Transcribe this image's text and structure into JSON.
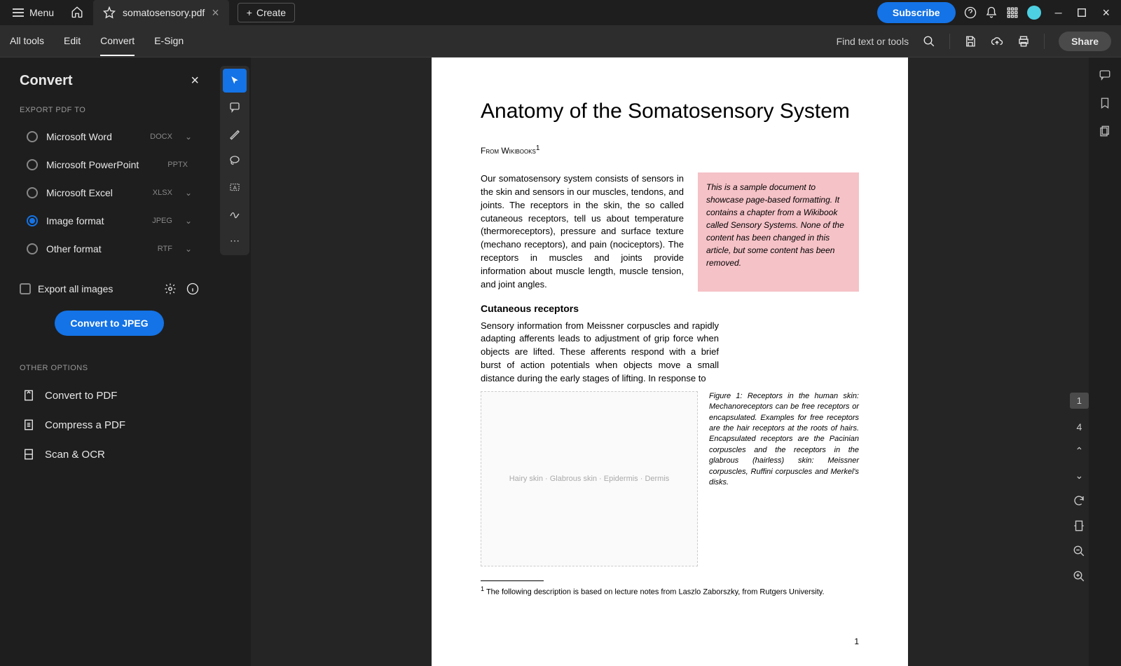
{
  "titlebar": {
    "menu": "Menu",
    "tab_title": "somatosensory.pdf",
    "create": "Create",
    "subscribe": "Subscribe"
  },
  "toolbar": {
    "all_tools": "All tools",
    "edit": "Edit",
    "convert": "Convert",
    "esign": "E-Sign",
    "find": "Find text or tools",
    "share": "Share"
  },
  "sidebar": {
    "title": "Convert",
    "export_label": "EXPORT PDF TO",
    "options": [
      {
        "name": "Microsoft Word",
        "ext": "DOCX",
        "chevron": true
      },
      {
        "name": "Microsoft PowerPoint",
        "ext": "PPTX",
        "chevron": false
      },
      {
        "name": "Microsoft Excel",
        "ext": "XLSX",
        "chevron": true
      },
      {
        "name": "Image format",
        "ext": "JPEG",
        "chevron": true,
        "selected": true
      },
      {
        "name": "Other format",
        "ext": "RTF",
        "chevron": true
      }
    ],
    "export_all": "Export all images",
    "convert_btn": "Convert to JPEG",
    "other_label": "OTHER OPTIONS",
    "other": [
      "Convert to PDF",
      "Compress a PDF",
      "Scan & OCR"
    ]
  },
  "doc": {
    "title": "Anatomy of the Somatosensory System",
    "source": "From Wikibooks",
    "para1": "Our somatosensory system consists of sensors in the skin and sensors in our muscles, tendons, and joints. The receptors in the skin, the so called cutaneous receptors, tell us about temperature (thermoreceptors), pressure and surface texture (mechano receptors), and pain (nociceptors). The receptors in muscles and joints provide information about muscle length, muscle tension, and joint angles.",
    "callout": "This is a sample document to showcase page-based formatting. It contains a chapter from a Wikibook called Sensory Systems. None of the content has been changed in this article, but some content has been removed.",
    "subhead": "Cutaneous receptors",
    "para2": "Sensory information from Meissner corpuscles and rapidly adapting afferents leads to adjustment of grip force when objects are lifted. These afferents respond with a brief burst of action potentials when objects move a small distance during the early stages of lifting. In response to",
    "figcaption": "Figure 1:  Receptors in the human skin: Mechanoreceptors can be free receptors or encapsulated. Examples for free receptors are the hair receptors at the roots of hairs. Encapsulated receptors are the Pacinian corpuscles and the receptors in the glabrous (hairless) skin: Meissner corpuscles, Ruffini corpuscles and Merkel's disks.",
    "figure_labels": "Hairy skin · Glabrous skin · Epidermis · Dermis",
    "footnote": "The following description is based on lecture notes from Laszlo Zaborszky, from Rutgers University.",
    "pagenum": "1"
  },
  "nav": {
    "current": "1",
    "total": "4"
  }
}
